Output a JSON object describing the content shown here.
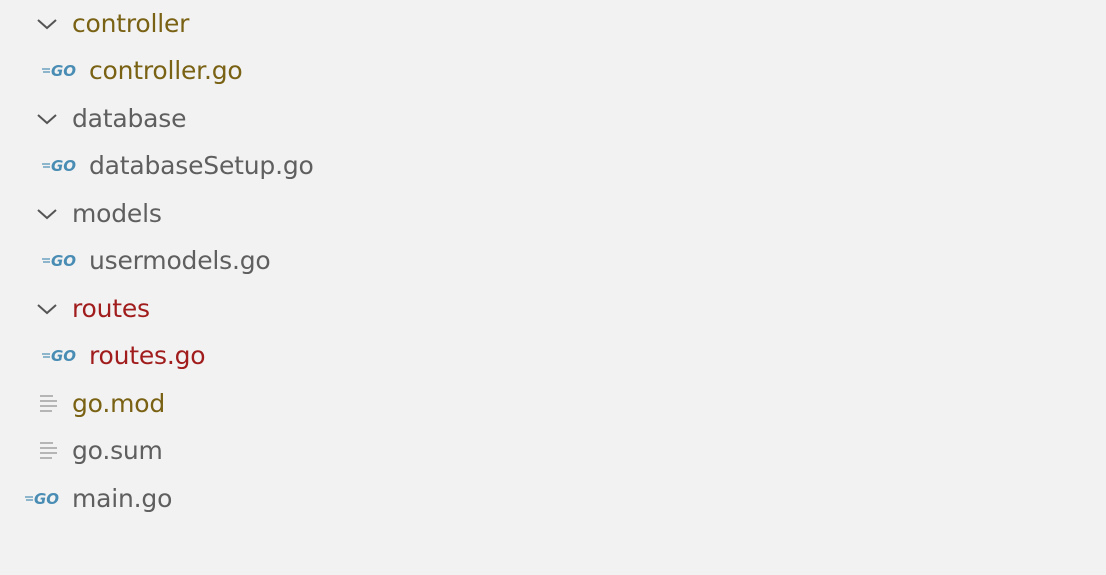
{
  "colors": {
    "modified": "#7a6214",
    "normal": "#5f5f5f",
    "error": "#a11d1d",
    "go_icon": "#4a8db4",
    "icon_gray": "#b5b5b5"
  },
  "tree": [
    {
      "label": "controller",
      "kind": "folder",
      "icon": "chevron-down-icon",
      "status": "modified"
    },
    {
      "label": "controller.go",
      "kind": "file",
      "icon": "go-file-icon",
      "status": "modified"
    },
    {
      "label": "database",
      "kind": "folder",
      "icon": "chevron-down-icon",
      "status": "normal"
    },
    {
      "label": "databaseSetup.go",
      "kind": "file",
      "icon": "go-file-icon",
      "status": "normal"
    },
    {
      "label": "models",
      "kind": "folder",
      "icon": "chevron-down-icon",
      "status": "normal"
    },
    {
      "label": "usermodels.go",
      "kind": "file",
      "icon": "go-file-icon",
      "status": "normal"
    },
    {
      "label": "routes",
      "kind": "folder",
      "icon": "chevron-down-icon",
      "status": "error"
    },
    {
      "label": "routes.go",
      "kind": "file",
      "icon": "go-file-icon",
      "status": "error"
    },
    {
      "label": "go.mod",
      "kind": "file",
      "icon": "text-file-icon",
      "status": "modified"
    },
    {
      "label": "go.sum",
      "kind": "file",
      "icon": "text-file-icon",
      "status": "normal"
    },
    {
      "label": "main.go",
      "kind": "file",
      "icon": "go-file-icon",
      "status": "normal"
    }
  ]
}
